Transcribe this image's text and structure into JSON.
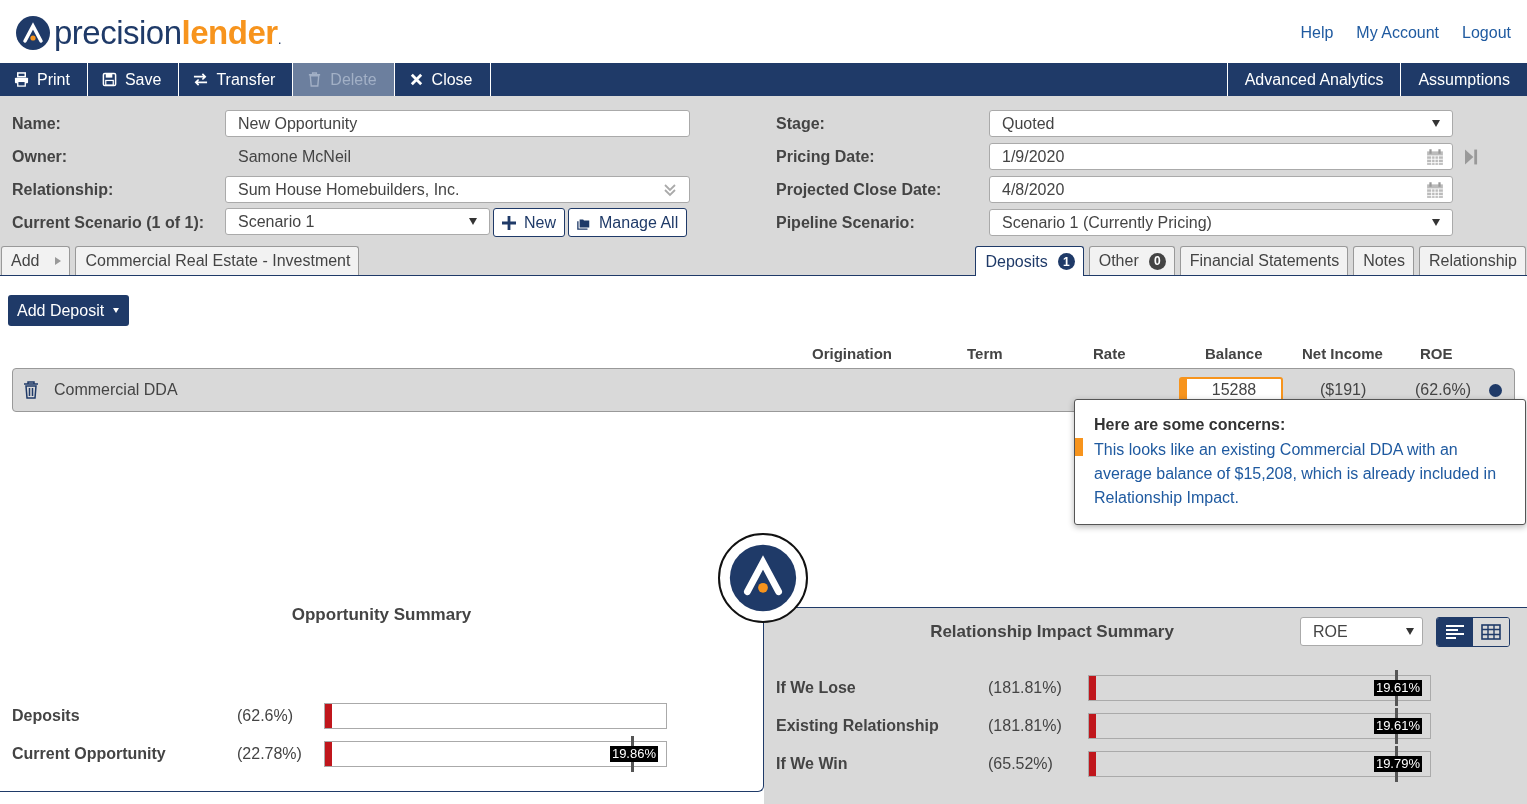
{
  "brand": {
    "name_left": "precision",
    "name_right": "lender",
    "mark": "."
  },
  "top_links": [
    "Help",
    "My Account",
    "Logout"
  ],
  "toolbar": {
    "left": [
      {
        "label": "Print",
        "disabled": false
      },
      {
        "label": "Save",
        "disabled": false
      },
      {
        "label": "Transfer",
        "disabled": false
      },
      {
        "label": "Delete",
        "disabled": true
      },
      {
        "label": "Close",
        "disabled": false
      }
    ],
    "right": [
      "Advanced Analytics",
      "Assumptions"
    ]
  },
  "form_left": [
    {
      "label": "Name:",
      "kind": "input",
      "value": "New Opportunity"
    },
    {
      "label": "Owner:",
      "kind": "text",
      "value": "Samone McNeil"
    },
    {
      "label": "Relationship:",
      "kind": "combo",
      "value": "Sum House Homebuilders, Inc."
    },
    {
      "label": "Current Scenario (1 of 1):",
      "kind": "scenario",
      "value": "Scenario 1",
      "buttons": [
        "New",
        "Manage All"
      ]
    }
  ],
  "form_right": [
    {
      "label": "Stage:",
      "kind": "select",
      "value": "Quoted"
    },
    {
      "label": "Pricing Date:",
      "kind": "date",
      "value": "1/9/2020",
      "skip": true
    },
    {
      "label": "Projected Close Date:",
      "kind": "date",
      "value": "4/8/2020",
      "skip": false
    },
    {
      "label": "Pipeline Scenario:",
      "kind": "select",
      "value": "Scenario 1 (Currently Pricing)"
    }
  ],
  "left_tabs": [
    {
      "label": "Add",
      "kind": "add"
    },
    {
      "label": "Commercial Real Estate - Investment",
      "kind": "plain"
    }
  ],
  "right_tabs": [
    {
      "label": "Deposits",
      "badge": "1",
      "selected": true
    },
    {
      "label": "Other",
      "badge": "0",
      "selected": false
    },
    {
      "label": "Financial Statements",
      "selected": false
    },
    {
      "label": "Notes",
      "selected": false
    },
    {
      "label": "Relationship",
      "selected": false
    }
  ],
  "add_deposit": "Add Deposit",
  "deposit_table": {
    "columns": [
      "Origination",
      "Term",
      "Rate",
      "Balance",
      "Net Income",
      "ROE"
    ],
    "rows": [
      {
        "name": "Commercial DDA",
        "balance": "15288",
        "net_income": "($191)",
        "roe": "(62.6%)",
        "color": "#1f3a68"
      }
    ]
  },
  "tooltip": {
    "title": "Here are some concerns:",
    "message": "This looks like an existing Commercial DDA with an average balance of $15,208, which is already included in Relationship Impact."
  },
  "opportunity_summary": {
    "title": "Opportunity Summary",
    "rows": [
      {
        "label": "Deposits",
        "value": "(62.6%)",
        "level": 0.02
      },
      {
        "label": "Current Opportunity",
        "value": "(22.78%)",
        "level": 0.02,
        "target": "19.86%"
      }
    ]
  },
  "relationship_impact": {
    "title": "Relationship Impact Summary",
    "metric": "ROE",
    "view": [
      {
        "selected": true
      },
      {
        "selected": false
      }
    ],
    "rows": [
      {
        "label": "If We Lose",
        "value": "(181.81%)",
        "level": 0.02,
        "target": "19.61%"
      },
      {
        "label": "Existing Relationship",
        "value": "(181.81%)",
        "level": 0.02,
        "target": "19.61%"
      },
      {
        "label": "If We Win",
        "value": "(65.52%)",
        "level": 0.02,
        "target": "19.79%"
      }
    ]
  }
}
